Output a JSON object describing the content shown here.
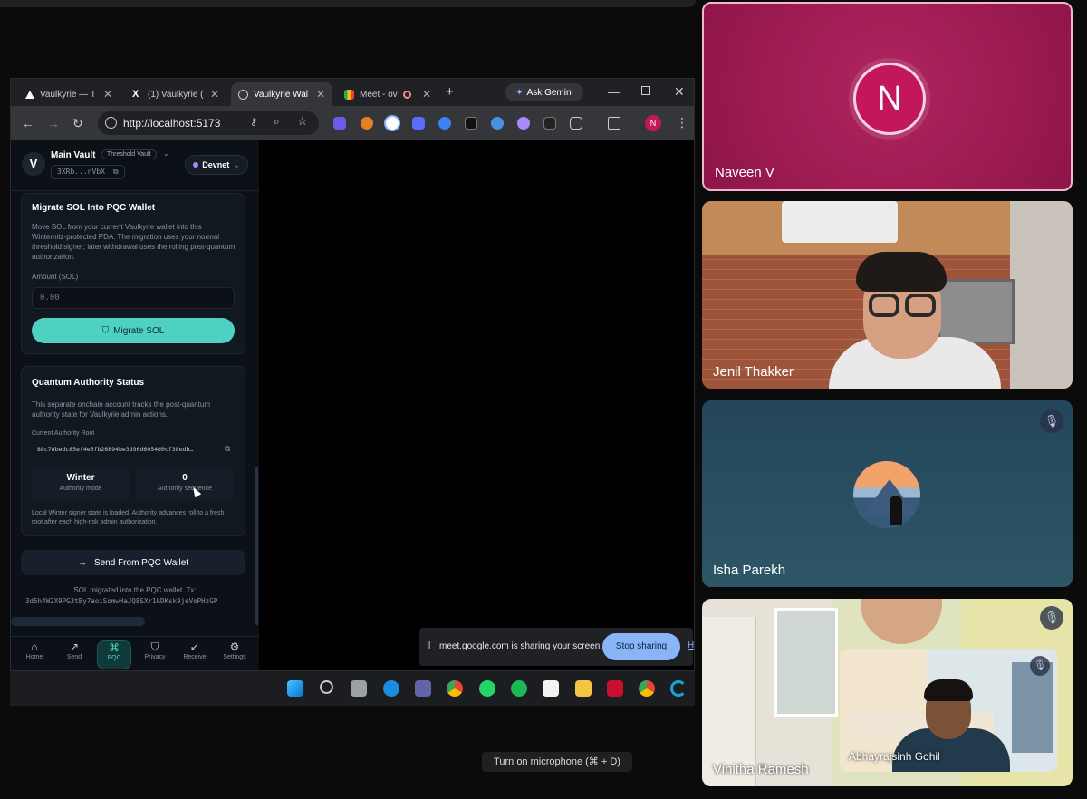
{
  "browser": {
    "tabs": [
      {
        "label": "Vaulkyrie — T",
        "icon": "triangle-icon"
      },
      {
        "label": "(1) Vaulkyrie (",
        "icon": "x-logo-icon"
      },
      {
        "label": "Vaulkyrie Wal",
        "icon": "globe-icon"
      },
      {
        "label": "Meet - ov",
        "icon": "meet-icon"
      }
    ],
    "ask_gemini": "Ask Gemini",
    "url": "http://localhost:5173",
    "profile_initial": "N"
  },
  "app": {
    "vault_name": "Main Vault",
    "vault_badge": "Threshold Vault",
    "vault_address": "3XRb...nVbX",
    "network": "Devnet",
    "migrate": {
      "title": "Migrate SOL Into PQC Wallet",
      "description": "Move SOL from your current Vaulkyrie wallet into this Winternitz-protected PDA. The migration uses your normal threshold signer; later withdrawal uses the rolling post-quantum authorization.",
      "amount_label": "Amount (SOL)",
      "amount_placeholder": "0.00",
      "button": "Migrate SOL"
    },
    "authority": {
      "title": "Quantum Authority Status",
      "description": "This separate onchain account tracks the post-quantum authority state for Vaulkyrie admin actions.",
      "root_label": "Current Authority Root",
      "root_value": "88c78bedc85ef4e5fb26894be3d96d6054d0cf38edb…",
      "mode_value": "Winter",
      "mode_label": "Authority mode",
      "sequence_value": "0",
      "sequence_label": "Authority sequence",
      "note": "Local Winter signer state is loaded. Authority advances roll to a fresh root after each high-risk admin authorization."
    },
    "send_button": "Send From PQC Wallet",
    "status_line1": "SOL migrated into the PQC wallet. Tx:",
    "status_line2": "3d5h4W2X9PG3tBy7aoiSomwHaJQ8SXr1kDKsk9jeVoPHzGP",
    "nav": [
      {
        "label": "Home",
        "icon": "home-icon"
      },
      {
        "label": "Send",
        "icon": "send-arrow-icon"
      },
      {
        "label": "PQC",
        "icon": "pqc-icon"
      },
      {
        "label": "Privacy",
        "icon": "shield-icon"
      },
      {
        "label": "Receive",
        "icon": "receive-arrow-icon"
      },
      {
        "label": "Settings",
        "icon": "gear-icon"
      }
    ]
  },
  "share": {
    "message": "meet.google.com is sharing your screen.",
    "stop_button": "Stop sharing",
    "hide_label": "H"
  },
  "meet": {
    "participants": [
      {
        "name": "Naveen V",
        "initial": "N"
      },
      {
        "name": "Jenil Thakker"
      },
      {
        "name": "Isha Parekh"
      },
      {
        "name": "Vinitha Ramesh"
      },
      {
        "name": "Abhayrajsinh Gohil"
      }
    ],
    "tooltip": "Turn on microphone (⌘ + D)"
  },
  "colors": {
    "accent_teal": "#4fd1c1",
    "naveen_tile": "#a01c55",
    "avatar_pink": "#c2185b",
    "stop_button": "#8ab4f8"
  }
}
